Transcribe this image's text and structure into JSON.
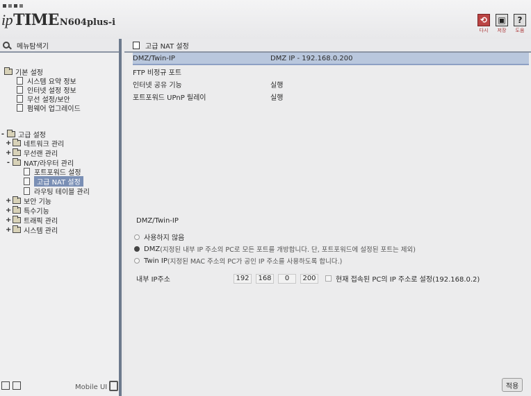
{
  "header": {
    "brand_ip": "ip",
    "brand_time": "TIME",
    "model": "N604plus-i",
    "icons": [
      {
        "name": "restart-icon",
        "label": "다시"
      },
      {
        "name": "save-icon",
        "label": "저장"
      },
      {
        "name": "help-icon",
        "label": "도움"
      }
    ]
  },
  "sidebar": {
    "title": "메뉴탐색기",
    "basic": {
      "label": "기본 설정",
      "items": [
        "시스템 요약 정보",
        "인터넷 설정 정보",
        "무선 설정/보안",
        "펌웨어 업그레이드"
      ]
    },
    "advanced": {
      "label": "고급 설정",
      "groups": [
        "네트워크 관리",
        "무선랜 관리",
        "NAT/라우터 관리"
      ],
      "nat_items": [
        "포트포워드 설정",
        "고급 NAT 설정",
        "라우팅 테이블 관리"
      ],
      "groups_after": [
        "보안 기능",
        "특수기능",
        "트래픽 관리",
        "시스템 관리"
      ]
    },
    "footer": {
      "mobile_ui": "Mobile UI"
    }
  },
  "main": {
    "title": "고급 NAT 설정",
    "rows": [
      {
        "key": "DMZ/Twin-IP",
        "value": "DMZ IP - 192.168.0.200"
      },
      {
        "key": "FTP 비정규 포트",
        "value": ""
      },
      {
        "key": "인터넷 공유 기능",
        "value": "실행"
      },
      {
        "key": "포트포워드 UPnP 릴레이",
        "value": "실행"
      }
    ],
    "section_title": "DMZ/Twin-IP",
    "options": [
      {
        "label": "사용하지 않음",
        "desc": "",
        "selected": false
      },
      {
        "label": "DMZ",
        "desc": " (지정된 내부 IP 주소의 PC로 모든 포트를 개방합니다. 단, 포트포워드에 설정된 포트는 제외)",
        "selected": true
      },
      {
        "label": "Twin IP",
        "desc": " (지정된 MAC 주소의 PC가 공인 IP 주소를 사용하도록 합니다.)",
        "selected": false
      }
    ],
    "ip_label": "내부 IP주소",
    "ip_octets": [
      "192",
      "168",
      "0",
      "200"
    ],
    "current_pc_text": "현재 접속된 PC의 IP 주소로 설정(192.168.0.2)",
    "apply_label": "적용"
  }
}
